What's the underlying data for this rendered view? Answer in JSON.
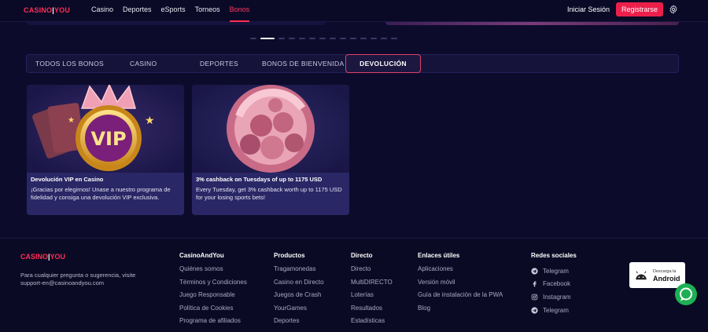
{
  "header": {
    "logo": {
      "left": "CASINO",
      "sep": "|",
      "right": "YOU"
    },
    "nav": [
      "Casino",
      "Deportes",
      "eSports",
      "Torneos",
      "Bonos"
    ],
    "active_nav": "Bonos",
    "login_label": "Iniciar Sesión",
    "register_label": "Registrarse",
    "settings_icon": "gear-icon",
    "accent_color": "#ec1f4b"
  },
  "carousel": {
    "slides": 14,
    "active_slide": 2
  },
  "tabs": [
    "TODOS LOS BONOS",
    "CASINO",
    "DEPORTES",
    "BONOS DE BIENVENIDA",
    "DEVOLUCIÓN"
  ],
  "active_tab": "DEVOLUCIÓN",
  "cards": [
    {
      "title": "Devolución VIP en Casino",
      "description": "¡Gracias por elegirnos! Unase a nuestro programa de fidelidad y consiga una devolución VIP exclusiva.",
      "image": "vip-crown-coin"
    },
    {
      "title": "3% cashback on Tuesdays of up to 1175 USD",
      "description": "Every Tuesday, get 3% cashback worth up to 1175 USD for your losing sports bets!",
      "image": "sports-balls-cashback"
    }
  ],
  "footer": {
    "logo": {
      "left": "CASINO",
      "sep": "|",
      "right": "YOU"
    },
    "contact": "Para cualquier pregunta o sugerencia, visite support-en@casinoandyou.com",
    "columns": [
      {
        "title": "CasinoAndYou",
        "items": [
          "Quiénes somos",
          "Términos y Condiciones",
          "Juego Responsable",
          "Política de Cookies",
          "Programa de afiliados"
        ]
      },
      {
        "title": "Productos",
        "items": [
          "Tragamonedas",
          "Casino en Directo",
          "Juegos de Crash",
          "YourGames",
          "Deportes"
        ]
      },
      {
        "title": "Directo",
        "items": [
          "Directo",
          "MultiDIRECTO",
          "Loterías",
          "Resultados",
          "Estadísticas"
        ]
      },
      {
        "title": "Enlaces útiles",
        "items": [
          "Aplicaciones",
          "Versión móvil",
          "Guía de instalación de la PWA",
          "Blog"
        ]
      }
    ],
    "social": {
      "title": "Redes sociales",
      "items": [
        {
          "label": "Telegram",
          "icon": "telegram-icon"
        },
        {
          "label": "Facebook",
          "icon": "facebook-icon"
        },
        {
          "label": "Instagram",
          "icon": "instagram-icon"
        },
        {
          "label": "Telegram",
          "icon": "telegram-icon"
        }
      ]
    },
    "android_badge": {
      "small": "Descarga la",
      "big": "Android"
    },
    "chat_icon": "chat-icon"
  }
}
